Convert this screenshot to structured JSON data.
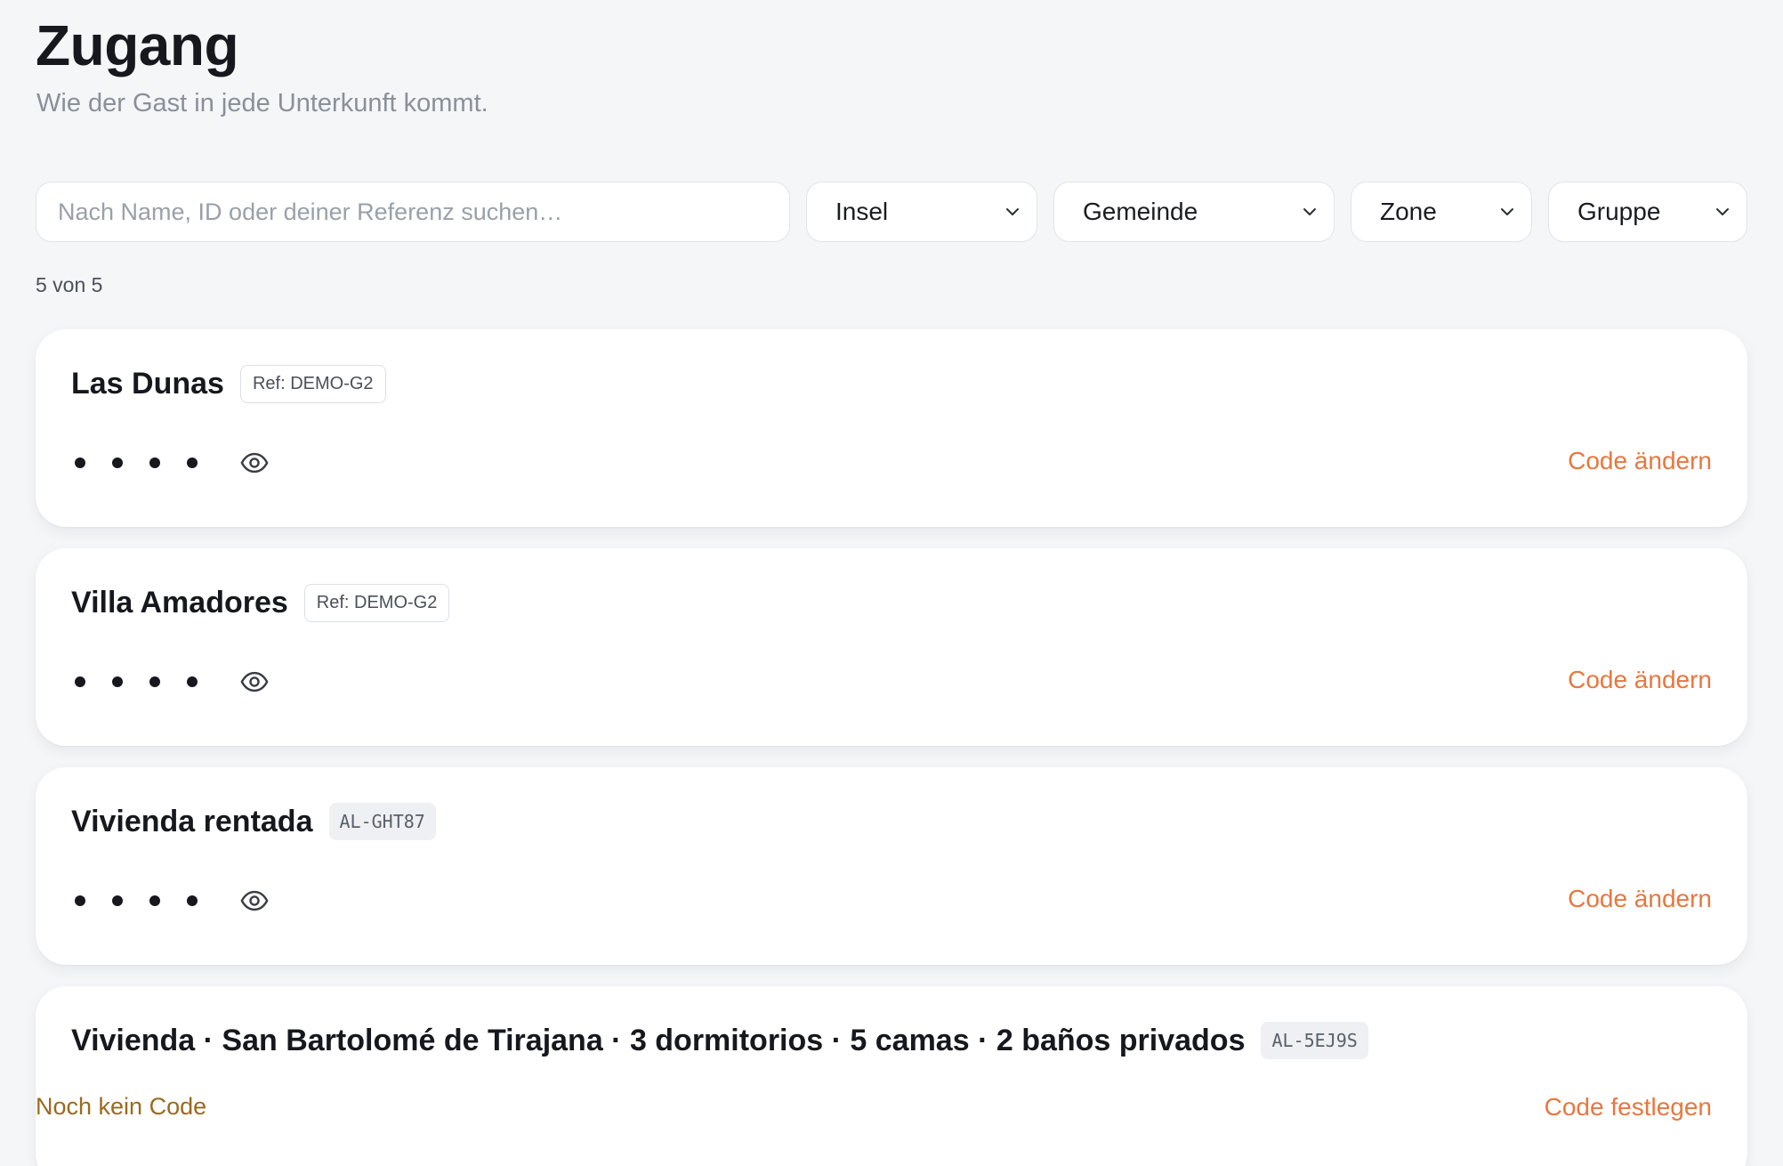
{
  "header": {
    "title": "Zugang",
    "subtitle": "Wie der Gast in jede Unterkunft kommt."
  },
  "filters": {
    "search_placeholder": "Nach Name, ID oder deiner Referenz suchen…",
    "search_value": "",
    "insel": "Insel",
    "gemeinde": "Gemeinde",
    "zone": "Zone",
    "gruppe": "Gruppe"
  },
  "count": "5 von 5",
  "cards": [
    {
      "name": "Las Dunas",
      "badge": "Ref: DEMO-G2",
      "badge_type": "ref",
      "code_state": "masked",
      "action": "Code ändern"
    },
    {
      "name": "Villa Amadores",
      "badge": "Ref: DEMO-G2",
      "badge_type": "ref",
      "code_state": "masked",
      "action": "Code ändern"
    },
    {
      "name": "Vivienda rentada",
      "badge": "AL-GHT87",
      "badge_type": "id",
      "code_state": "masked",
      "action": "Code ändern"
    },
    {
      "name": "Vivienda · San Bartolomé de Tirajana · 3 dormitorios · 5 camas · 2 baños privados",
      "badge": "AL-5EJ9S",
      "badge_type": "id",
      "code_state": "Noch kein Code",
      "action": "Code festlegen"
    }
  ],
  "icons": {
    "reveal": "eye-icon",
    "dropdown": "chevron-down-icon"
  },
  "colors": {
    "accent": "#e8773f",
    "warning_text": "#9a6a1f",
    "background": "#f5f6f8"
  }
}
